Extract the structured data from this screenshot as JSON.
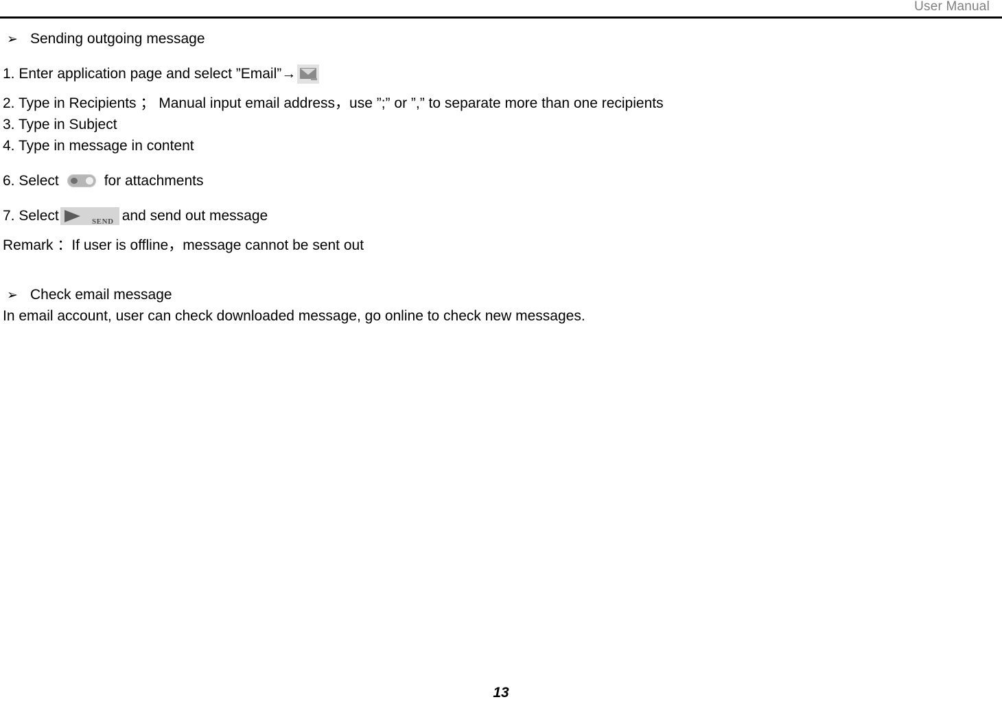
{
  "header": {
    "title": "User Manual"
  },
  "sections": {
    "bullet_glyph": "➢",
    "section1_heading": "Sending outgoing message",
    "step1_before": "1. Enter application page and select ”Email”→",
    "step2": "2. Type in Recipients ； Manual input email address，use ”;” or ”,” to separate more than one recipients",
    "step3": "3. Type in Subject",
    "step4": "4. Type in message in content",
    "step6_before": "6. Select",
    "step6_after": "for attachments",
    "step7_before": "7. Select",
    "step7_after": "and send out message",
    "remark": "Remark ：If user is offline，message cannot be sent out",
    "section2_heading": "Check email message",
    "section2_body": "In email account, user can check downloaded message, go online to check new messages."
  },
  "icons": {
    "email_icon_name": "email-envelope-icon",
    "attach_icon_name": "attachment-button-icon",
    "send_icon_name": "send-button-icon",
    "send_label": "SEND"
  },
  "footer": {
    "page_number": "13"
  },
  "colors": {
    "header_text": "#808080",
    "rule": "#000000",
    "body_text": "#000000",
    "icon_gray": "#8a8a8a",
    "icon_bg": "#d5d5d5"
  }
}
